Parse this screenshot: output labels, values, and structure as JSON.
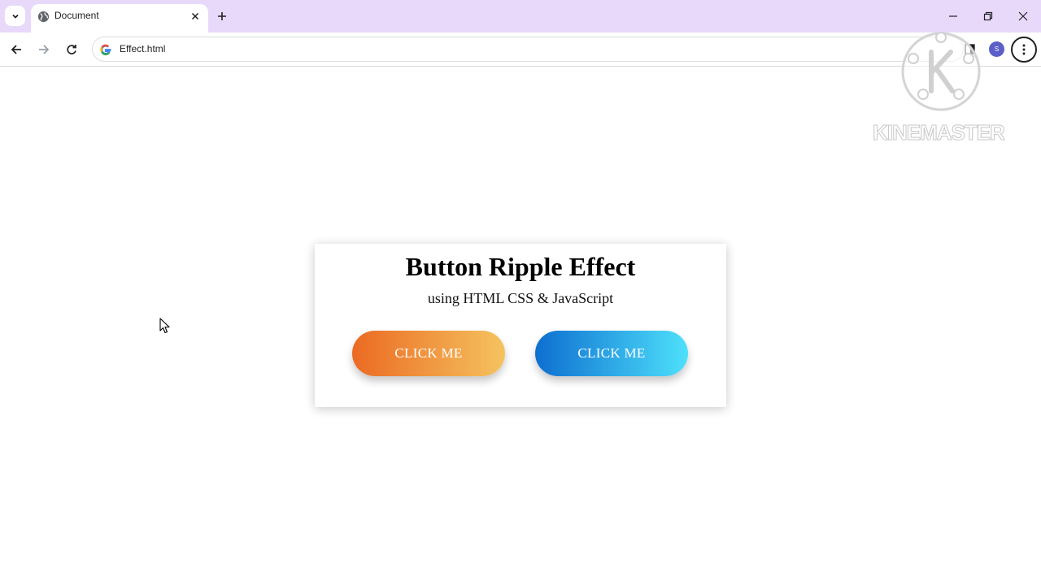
{
  "browser": {
    "tab": {
      "title": "Document"
    },
    "address_bar": {
      "url": "Effect.html"
    },
    "profile_initial": "S"
  },
  "page": {
    "title": "Button Ripple Effect",
    "subtitle": "using HTML CSS & JavaScript",
    "buttons": [
      {
        "label": "CLICK ME",
        "gradient": [
          "#eb6a23",
          "#f5c35f"
        ]
      },
      {
        "label": "CLICK ME",
        "gradient": [
          "#0d6fd0",
          "#4ee0fb"
        ]
      }
    ]
  },
  "watermark": {
    "text": "KINEMASTER"
  },
  "colors": {
    "tabstrip": "#e8d9fb",
    "profile": "#5b5fc7"
  },
  "icons": [
    "chevron-down-icon",
    "globe-icon",
    "close-icon",
    "plus-icon",
    "minimize-icon",
    "restore-icon",
    "back-arrow-icon",
    "forward-arrow-icon",
    "reload-icon",
    "google-icon",
    "side-panel-icon",
    "more-vert-icon",
    "mouse-cursor-icon"
  ]
}
